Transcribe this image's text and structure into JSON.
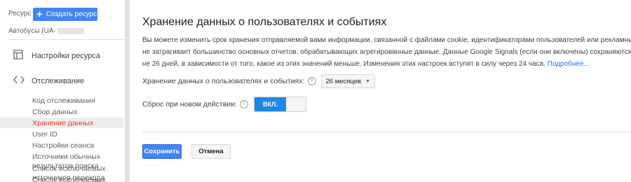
{
  "sidebar": {
    "resource_label": "Ресурс",
    "create_button": "Создать ресурс",
    "property_name": "Автобусы (UA-",
    "nav": [
      {
        "label": "Настройки ресурса",
        "icon": "property-settings-icon"
      },
      {
        "label": "Отслеживание",
        "icon": "code-icon"
      }
    ],
    "sub_items": [
      {
        "label": "Код отслеживания"
      },
      {
        "label": "Сбор данных"
      },
      {
        "label": "Хранение данных"
      },
      {
        "label": "User ID"
      },
      {
        "label": "Настройки сеанса"
      },
      {
        "label": "Источники обычных результатов поиска"
      },
      {
        "label": "Список исключаемых источников перехода"
      },
      {
        "label": "Список исключаемых"
      }
    ],
    "active_item": "Хранение данных"
  },
  "main": {
    "title": "Хранение данных о пользователях и событиях",
    "description_lines": [
      "Вы можете изменить срок хранения отправляемой вами информации, связанной с файлами cookie, идентификаторами пользователей или рекламными идентификаторами. Это",
      "не затрагивает большинство основных отчетов, обрабатывающих агрегированные данные. Данные Google Signals (если они включены) сохраняются",
      "не 26 дней, в зависимости от того, какое из этих значений меньше. Изменения этих настроек вступят в силу через 24 часа."
    ],
    "learn_more": "Подробнее...",
    "retention": {
      "label": "Хранение данных о пользователях и событиях:",
      "help": "?",
      "value": "26 месяцев"
    },
    "reset": {
      "label": "Сброс при новом действии:",
      "help": "?",
      "toggle_on": "ВКЛ."
    },
    "save_button": "Сохранить",
    "cancel_button": "Отмена"
  },
  "colors": {
    "accent": "#4285f4",
    "toggle_on": "#1e88e5",
    "active_nav": "#e53935",
    "link": "#1a73e8"
  }
}
